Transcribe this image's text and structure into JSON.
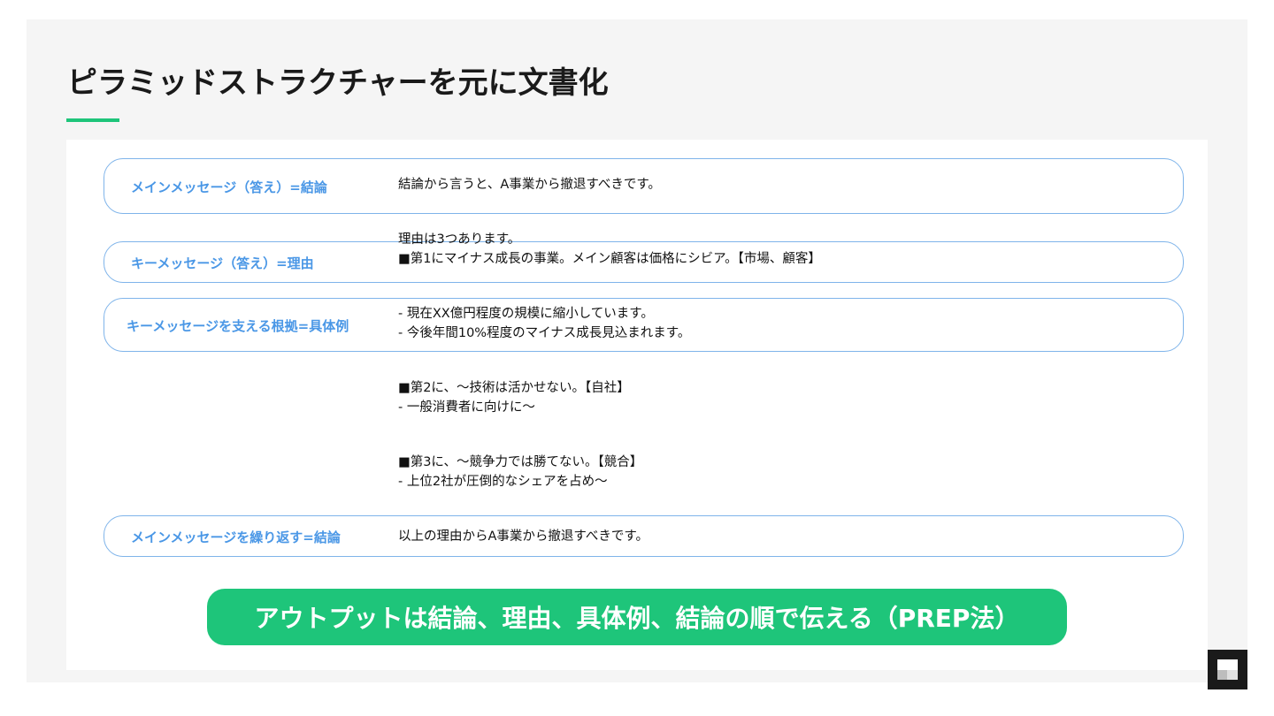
{
  "title": "ピラミッドストラクチャーを元に文書化",
  "rows": [
    {
      "label": "メインメッセージ（答え）=結論",
      "lines": [
        "結論から言うと、A事業から撤退すべきです。"
      ]
    },
    {
      "label": "キーメッセージ（答え）=理由",
      "lines": [
        "理由は3つあります。",
        "■第1にマイナス成長の事業。メイン顧客は価格にシビア。【市場、顧客】"
      ]
    },
    {
      "label": "キーメッセージを支える根拠=具体例",
      "lines": [
        "- 現在XX億円程度の規模に縮小しています。",
        "- 今後年間10%程度のマイナス成長見込まれます。"
      ]
    },
    {
      "label": "メインメッセージを繰り返す=結論",
      "lines": [
        "以上の理由からA事業から撤退すべきです。"
      ]
    }
  ],
  "extra_blocks": [
    {
      "lines": [
        "■第2に、〜技術は活かせない。【自社】",
        "- 一般消費者に向けに〜"
      ]
    },
    {
      "lines": [
        "■第3に、〜競争力では勝てない。【競合】",
        "- 上位2社が圧倒的なシェアを占め〜"
      ]
    }
  ],
  "cta": "アウトプットは結論、理由、具体例、結論の順で伝える（PREP法）",
  "colors": {
    "accent_green": "#1ec57a",
    "label_blue": "#4a97e6",
    "pill_border": "#7fb4ea",
    "background": "#f5f5f5"
  },
  "icons": [
    "brand-logo-icon"
  ]
}
